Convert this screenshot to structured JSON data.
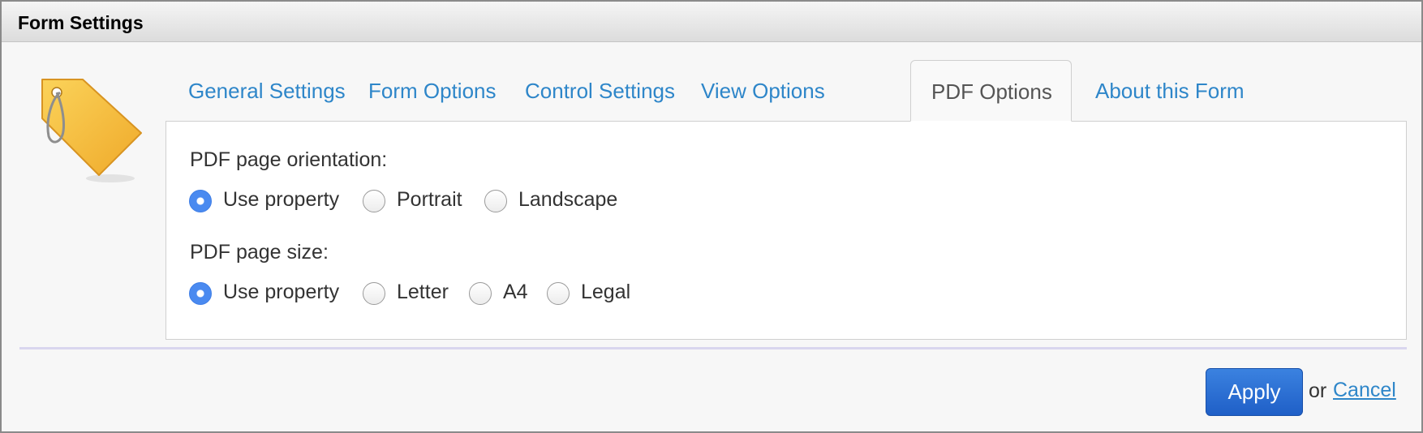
{
  "window": {
    "title": "Form Settings"
  },
  "icon": {
    "name": "tag-icon",
    "color": "#f2b632"
  },
  "tabs": [
    {
      "label": "General Settings",
      "active": false
    },
    {
      "label": "Form Options",
      "active": false
    },
    {
      "label": "Control Settings",
      "active": false
    },
    {
      "label": "View Options",
      "active": false
    },
    {
      "label": "PDF Options",
      "active": true
    },
    {
      "label": "About this Form",
      "active": false
    }
  ],
  "pdf": {
    "orientation": {
      "label": "PDF page orientation:",
      "options": [
        "Use property",
        "Portrait",
        "Landscape"
      ],
      "selected": "Use property"
    },
    "size": {
      "label": "PDF page size:",
      "options": [
        "Use property",
        "Letter",
        "A4",
        "Legal"
      ],
      "selected": "Use property"
    }
  },
  "actions": {
    "apply": "Apply",
    "or": "or",
    "cancel": "Cancel"
  },
  "colors": {
    "link": "#2e86c9",
    "primary": "#2563d0",
    "radio_checked": "#4a8af0"
  }
}
